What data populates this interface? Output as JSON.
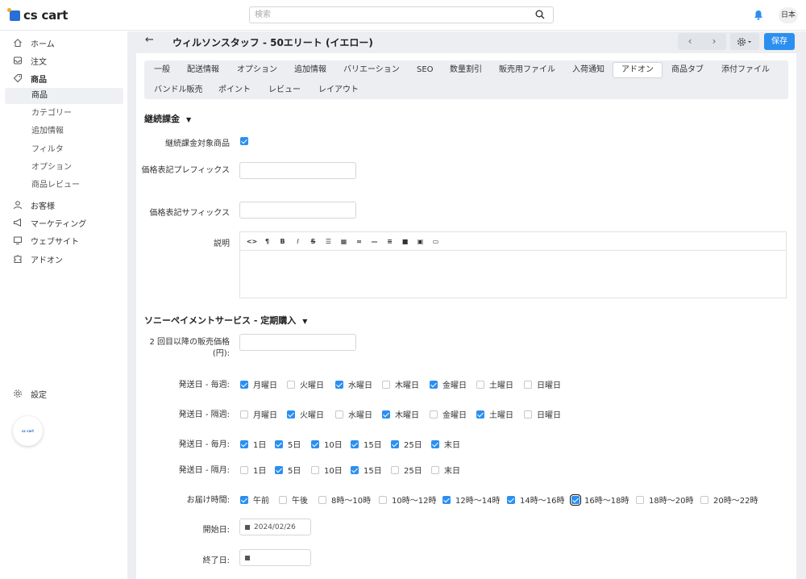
{
  "brand": {
    "logo_text": "cs cart",
    "accent": "#2b8ff0"
  },
  "search": {
    "placeholder": "検索"
  },
  "header": {
    "language": "日本"
  },
  "sidebar": {
    "items": [
      {
        "label": "ホーム",
        "icon": "home-icon"
      },
      {
        "label": "注文",
        "icon": "inbox-icon"
      },
      {
        "label": "商品",
        "icon": "tag-icon"
      },
      {
        "label": "お客様",
        "icon": "user-icon"
      },
      {
        "label": "マーケティング",
        "icon": "megaphone-icon"
      },
      {
        "label": "ウェブサイト",
        "icon": "monitor-icon"
      },
      {
        "label": "アドオン",
        "icon": "puzzle-icon"
      }
    ],
    "sub_items": [
      "商品",
      "カテゴリー",
      "追加情報",
      "フィルタ",
      "オプション",
      "商品レビュー"
    ],
    "settings": "設定",
    "footer_logo": "cs cart"
  },
  "page": {
    "title": "ウィルソンスタッフ - 50エリート (イエロー)",
    "save": "保存"
  },
  "tabs": [
    "一般",
    "配送情報",
    "オプション",
    "追加情報",
    "バリエーション",
    "SEO",
    "数量割引",
    "販売用ファイル",
    "入荷通知",
    "アドオン",
    "商品タブ",
    "添付ファイル",
    "バンドル販売",
    "ポイント",
    "レビュー",
    "レイアウト"
  ],
  "active_tab": "アドオン",
  "subscription": {
    "title": "継続課金",
    "target_label": "継続課金対象商品",
    "prefix_label": "価格表記プレフィックス",
    "suffix_label": "価格表記サフィックス",
    "description_label": "説明"
  },
  "sony": {
    "title": "ソニーペイメントサービス - 定期購入",
    "price_label": "2 回目以降の販売価格 (円):",
    "weekly_label": "発送日 - 毎週:",
    "biweekly_label": "発送日 - 隔週:",
    "monthly_label": "発送日 - 毎月:",
    "bimonthly_label": "発送日 - 隔月:",
    "delivery_label": "お届け時間:",
    "start_label": "開始日:",
    "end_label": "終了日:",
    "start_value": "2024/02/26",
    "weekdays": [
      "月曜日",
      "火曜日",
      "水曜日",
      "木曜日",
      "金曜日",
      "土曜日",
      "日曜日"
    ],
    "weekly_checked": [
      true,
      false,
      true,
      false,
      true,
      false,
      false
    ],
    "biweekly_checked": [
      false,
      true,
      false,
      true,
      false,
      true,
      false
    ],
    "monthdays": [
      "1日",
      "5日",
      "10日",
      "15日",
      "25日",
      "末日"
    ],
    "monthly_checked": [
      true,
      true,
      true,
      true,
      true,
      true
    ],
    "bimonthly_checked": [
      false,
      true,
      false,
      true,
      false,
      false
    ],
    "times": [
      "午前",
      "午後",
      "8時～10時",
      "10時～12時",
      "12時～14時",
      "14時～16時",
      "16時～18時",
      "18時～20時",
      "20時～22時"
    ],
    "times_checked": [
      true,
      false,
      false,
      false,
      true,
      true,
      true,
      false,
      false
    ]
  }
}
